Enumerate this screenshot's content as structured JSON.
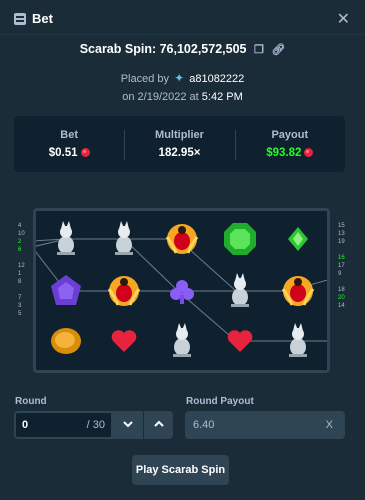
{
  "header": {
    "title": "Bet",
    "close_icon": "close-icon",
    "menu_icon": "bet-list-icon"
  },
  "spin": {
    "title": "Scarab Spin: 76,102,572,505",
    "placed_prefix": "Placed by",
    "username": "a81082222",
    "date_prefix": "on 2/19/2022 at",
    "time": "5:42 PM"
  },
  "stats": {
    "bet_label": "Bet",
    "bet_value": "$0.51",
    "multiplier_label": "Multiplier",
    "multiplier_value": "182.95×",
    "payout_label": "Payout",
    "payout_value": "$93.82",
    "payout_color": "#1fff20",
    "currency_icon": "ruby-gem-icon"
  },
  "board": {
    "left_numbers": [
      "4",
      "10",
      "2",
      "6",
      "",
      "12",
      "1",
      "8",
      "",
      "7",
      "3",
      "5"
    ],
    "left_highlight": [
      "2",
      "6"
    ],
    "right_numbers": [
      "15",
      "13",
      "19",
      "",
      "16",
      "17",
      "9",
      "",
      "18",
      "20",
      "14"
    ],
    "right_highlight": [
      "16",
      "20"
    ],
    "symbols": [
      [
        "white-cat-statue",
        "white-cat-statue",
        "golden-scarab",
        "green-octagon-gem",
        "green-diamond-gem"
      ],
      [
        "purple-pentagon-gem",
        "golden-scarab",
        "purple-club-gem",
        "white-cat-statue",
        "golden-scarab"
      ],
      [
        "gold-coin",
        "red-heart-gem",
        "white-cat-statue",
        "red-heart-gem",
        "white-cat-statue"
      ]
    ]
  },
  "controls": {
    "round_label": "Round",
    "round_value": "0",
    "round_suffix": "/ 30",
    "payout_label": "Round Payout",
    "payout_value": "6.40",
    "payout_clear": "X"
  },
  "play_button": "Play Scarab Spin"
}
